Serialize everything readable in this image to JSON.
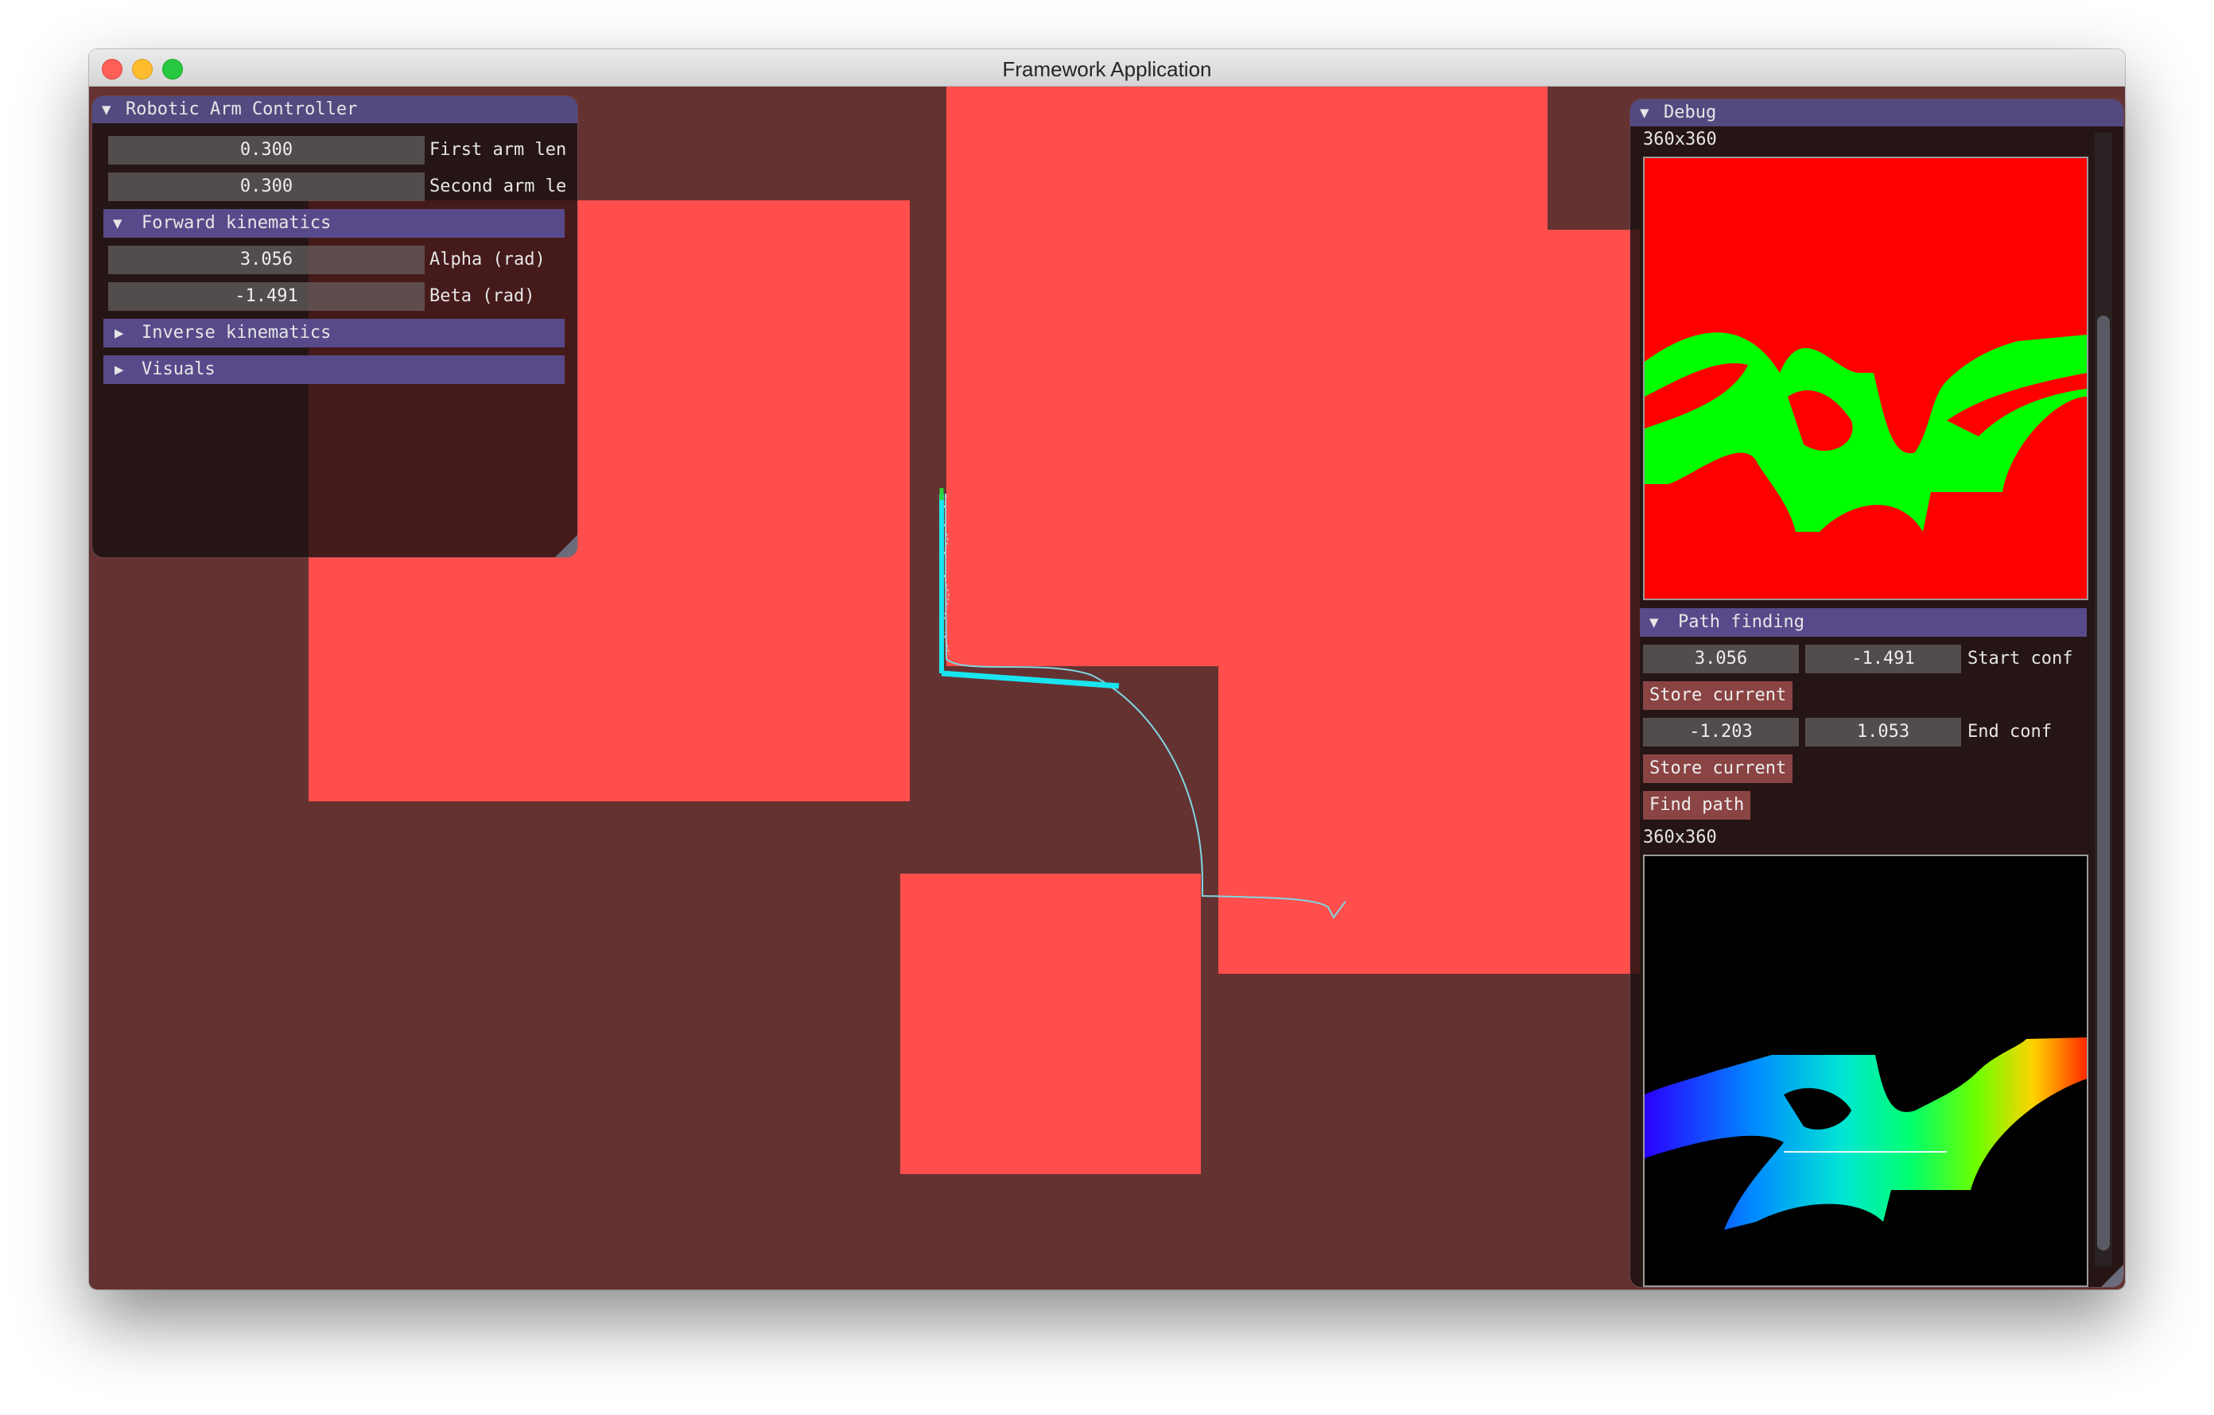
{
  "window": {
    "title": "Framework Application"
  },
  "controller": {
    "title": "Robotic Arm Controller",
    "first_arm": {
      "value": "0.300",
      "label": "First arm len"
    },
    "second_arm": {
      "value": "0.300",
      "label": "Second arm le"
    },
    "forward": {
      "title": "Forward kinematics",
      "alpha": {
        "value": "3.056",
        "label": "Alpha (rad)"
      },
      "beta": {
        "value": "-1.491",
        "label": "Beta (rad)"
      }
    },
    "inverse": {
      "title": "Inverse kinematics"
    },
    "visuals": {
      "title": "Visuals"
    }
  },
  "debug": {
    "title": "Debug",
    "image1_size": "360x360",
    "path_finding": {
      "title": "Path finding",
      "start": {
        "alpha": "3.056",
        "beta": "-1.491",
        "label": "Start conf"
      },
      "store_start": "Store current",
      "end": {
        "alpha": "-1.203",
        "beta": "1.053",
        "label": "End conf"
      },
      "store_end": "Store current",
      "find_path": "Find path"
    },
    "image2_size": "360x360"
  },
  "colors": {
    "scene_background": "#653232",
    "obstacle": "#ff4e4c",
    "arm": "#19e5f0",
    "header_accent": "#534a80",
    "button": "#8a4443",
    "config_free": "#00ff00",
    "config_blocked": "#ff0000"
  },
  "icons": {
    "expanded": "▼",
    "collapsed": "▶"
  }
}
